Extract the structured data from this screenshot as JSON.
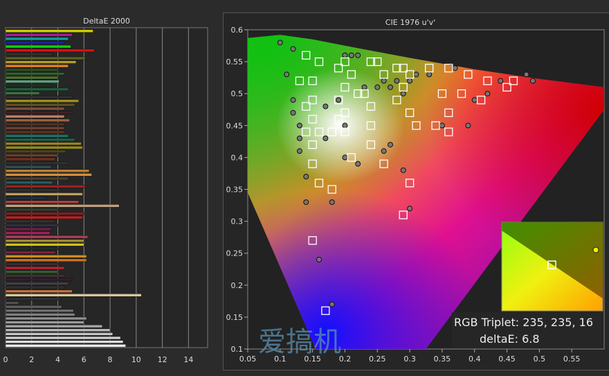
{
  "chart_data": [
    {
      "type": "bar",
      "orientation": "horizontal",
      "title": "DeltaE 2000",
      "xlim": [
        0,
        15
      ],
      "xticks": [
        "0",
        "2",
        "4",
        "6",
        "8",
        "10",
        "12",
        "14"
      ],
      "grid": true,
      "bars": [
        {
          "v": 6.7,
          "c": "#d8d000"
        },
        {
          "v": 5.1,
          "c": "#a020a0"
        },
        {
          "v": 4.8,
          "c": "#10a0a0"
        },
        {
          "v": 4.5,
          "c": "#2020a0"
        },
        {
          "v": 5.0,
          "c": "#10d010"
        },
        {
          "v": 6.8,
          "c": "#e01010"
        },
        {
          "v": 3.6,
          "c": "#303030"
        },
        {
          "v": 6.1,
          "c": "#606020"
        },
        {
          "v": 5.4,
          "c": "#b0a020"
        },
        {
          "v": 4.8,
          "c": "#e08020"
        },
        {
          "v": 4.0,
          "c": "#305020"
        },
        {
          "v": 4.5,
          "c": "#306030"
        },
        {
          "v": 4.0,
          "c": "#507030"
        },
        {
          "v": 4.1,
          "c": "#60a080"
        },
        {
          "v": 3.5,
          "c": "#203020"
        },
        {
          "v": 4.8,
          "c": "#206040"
        },
        {
          "v": 2.6,
          "c": "#407040"
        },
        {
          "v": 5.1,
          "c": "#303030"
        },
        {
          "v": 5.6,
          "c": "#a09020"
        },
        {
          "v": 5.3,
          "c": "#605020"
        },
        {
          "v": 4.5,
          "c": "#805040"
        },
        {
          "v": 5.1,
          "c": "#402020"
        },
        {
          "v": 4.5,
          "c": "#c08060"
        },
        {
          "v": 4.9,
          "c": "#a06040"
        },
        {
          "v": 4.5,
          "c": "#503020"
        },
        {
          "v": 4.5,
          "c": "#704030"
        },
        {
          "v": 4.5,
          "c": "#603020"
        },
        {
          "v": 4.8,
          "c": "#207060"
        },
        {
          "v": 5.3,
          "c": "#206050"
        },
        {
          "v": 5.8,
          "c": "#a08020"
        },
        {
          "v": 5.9,
          "c": "#909020"
        },
        {
          "v": 4.6,
          "c": "#504020"
        },
        {
          "v": 4.0,
          "c": "#604030"
        },
        {
          "v": 3.8,
          "c": "#703020"
        },
        {
          "v": 4.8,
          "c": "#303030"
        },
        {
          "v": 3.5,
          "c": "#305050"
        },
        {
          "v": 6.4,
          "c": "#c08030"
        },
        {
          "v": 6.6,
          "c": "#d09040"
        },
        {
          "v": 4.8,
          "c": "#504030"
        },
        {
          "v": 3.6,
          "c": "#206060"
        },
        {
          "v": 6.1,
          "c": "#a02020"
        },
        {
          "v": 4.2,
          "c": "#303030"
        },
        {
          "v": 5.9,
          "c": "#c0a060"
        },
        {
          "v": 3.1,
          "c": "#203040"
        },
        {
          "v": 5.6,
          "c": "#b04040"
        },
        {
          "v": 8.7,
          "c": "#c0a080"
        },
        {
          "v": 4.0,
          "c": "#304030"
        },
        {
          "v": 6.0,
          "c": "#802020"
        },
        {
          "v": 5.9,
          "c": "#c02020"
        },
        {
          "v": 3.8,
          "c": "#303030"
        },
        {
          "v": 4.0,
          "c": "#303040"
        },
        {
          "v": 3.5,
          "c": "#702040"
        },
        {
          "v": 3.4,
          "c": "#a02060"
        },
        {
          "v": 6.3,
          "c": "#b04050"
        },
        {
          "v": 6.0,
          "c": "#a09030"
        },
        {
          "v": 6.0,
          "c": "#d0c020"
        },
        {
          "v": 4.0,
          "c": "#203020"
        },
        {
          "v": 3.8,
          "c": "#802040"
        },
        {
          "v": 6.2,
          "c": "#d09020"
        },
        {
          "v": 6.2,
          "c": "#d07020"
        },
        {
          "v": 4.0,
          "c": "#303030"
        },
        {
          "v": 4.5,
          "c": "#c02030"
        },
        {
          "v": 4.0,
          "c": "#306030"
        },
        {
          "v": 4.5,
          "c": "#403030"
        },
        {
          "v": 5.1,
          "c": "#302030"
        },
        {
          "v": 4.8,
          "c": "#404040"
        },
        {
          "v": 4.5,
          "c": "#303030"
        },
        {
          "v": 5.1,
          "c": "#c07040"
        },
        {
          "v": 10.4,
          "c": "#d8c8a0"
        },
        {
          "v": 4.2,
          "c": "#303030"
        },
        {
          "v": 1.0,
          "c": "#505050"
        },
        {
          "v": 4.3,
          "c": "#606060"
        },
        {
          "v": 5.2,
          "c": "#707070"
        },
        {
          "v": 5.3,
          "c": "#808080"
        },
        {
          "v": 6.2,
          "c": "#909090"
        },
        {
          "v": 6.0,
          "c": "#9a9a9a"
        },
        {
          "v": 7.4,
          "c": "#a8a8a8"
        },
        {
          "v": 8.0,
          "c": "#b8b8b8"
        },
        {
          "v": 8.2,
          "c": "#c4c4c4"
        },
        {
          "v": 8.8,
          "c": "#d0d0d0"
        },
        {
          "v": 9.0,
          "c": "#dedede"
        },
        {
          "v": 9.2,
          "c": "#eeeeee"
        }
      ]
    },
    {
      "type": "scatter",
      "title": "CIE 1976 u'v'",
      "xlim": [
        0.05,
        0.6
      ],
      "ylim": [
        0.1,
        0.6
      ],
      "xticks": [
        "0.05",
        "0.1",
        "0.15",
        "0.2",
        "0.25",
        "0.3",
        "0.35",
        "0.4",
        "0.45",
        "0.5",
        "0.55"
      ],
      "yticks": [
        "0.1",
        "0.15",
        "0.2",
        "0.25",
        "0.3",
        "0.35",
        "0.4",
        "0.45",
        "0.5",
        "0.55",
        "0.6"
      ],
      "targets": [
        [
          0.14,
          0.56
        ],
        [
          0.16,
          0.55
        ],
        [
          0.15,
          0.52
        ],
        [
          0.13,
          0.52
        ],
        [
          0.15,
          0.49
        ],
        [
          0.14,
          0.48
        ],
        [
          0.15,
          0.46
        ],
        [
          0.14,
          0.44
        ],
        [
          0.16,
          0.44
        ],
        [
          0.15,
          0.42
        ],
        [
          0.15,
          0.39
        ],
        [
          0.16,
          0.36
        ],
        [
          0.18,
          0.35
        ],
        [
          0.15,
          0.27
        ],
        [
          0.17,
          0.16
        ],
        [
          0.2,
          0.55
        ],
        [
          0.19,
          0.54
        ],
        [
          0.21,
          0.53
        ],
        [
          0.2,
          0.51
        ],
        [
          0.19,
          0.49
        ],
        [
          0.2,
          0.47
        ],
        [
          0.19,
          0.46
        ],
        [
          0.2,
          0.44
        ],
        [
          0.18,
          0.44
        ],
        [
          0.21,
          0.4
        ],
        [
          0.23,
          0.5
        ],
        [
          0.24,
          0.55
        ],
        [
          0.25,
          0.55
        ],
        [
          0.26,
          0.53
        ],
        [
          0.24,
          0.48
        ],
        [
          0.24,
          0.45
        ],
        [
          0.24,
          0.42
        ],
        [
          0.26,
          0.39
        ],
        [
          0.28,
          0.54
        ],
        [
          0.29,
          0.54
        ],
        [
          0.3,
          0.53
        ],
        [
          0.29,
          0.51
        ],
        [
          0.28,
          0.49
        ],
        [
          0.3,
          0.47
        ],
        [
          0.31,
          0.45
        ],
        [
          0.3,
          0.36
        ],
        [
          0.29,
          0.31
        ],
        [
          0.33,
          0.54
        ],
        [
          0.36,
          0.54
        ],
        [
          0.35,
          0.5
        ],
        [
          0.36,
          0.47
        ],
        [
          0.36,
          0.44
        ],
        [
          0.34,
          0.45
        ],
        [
          0.39,
          0.53
        ],
        [
          0.41,
          0.49
        ],
        [
          0.42,
          0.52
        ],
        [
          0.45,
          0.51
        ],
        [
          0.46,
          0.52
        ],
        [
          0.38,
          0.5
        ],
        [
          0.22,
          0.5
        ]
      ],
      "measured": [
        [
          0.1,
          0.58
        ],
        [
          0.12,
          0.57
        ],
        [
          0.11,
          0.53
        ],
        [
          0.12,
          0.49
        ],
        [
          0.12,
          0.47
        ],
        [
          0.13,
          0.43
        ],
        [
          0.13,
          0.41
        ],
        [
          0.14,
          0.37
        ],
        [
          0.14,
          0.33
        ],
        [
          0.16,
          0.24
        ],
        [
          0.18,
          0.33
        ],
        [
          0.18,
          0.17
        ],
        [
          0.17,
          0.43
        ],
        [
          0.2,
          0.45
        ],
        [
          0.2,
          0.4
        ],
        [
          0.22,
          0.39
        ],
        [
          0.21,
          0.56
        ],
        [
          0.22,
          0.56
        ],
        [
          0.23,
          0.51
        ],
        [
          0.25,
          0.51
        ],
        [
          0.27,
          0.42
        ],
        [
          0.26,
          0.41
        ],
        [
          0.29,
          0.38
        ],
        [
          0.3,
          0.32
        ],
        [
          0.29,
          0.5
        ],
        [
          0.31,
          0.53
        ],
        [
          0.35,
          0.45
        ],
        [
          0.39,
          0.45
        ],
        [
          0.4,
          0.49
        ],
        [
          0.42,
          0.5
        ],
        [
          0.44,
          0.52
        ],
        [
          0.49,
          0.52
        ],
        [
          0.48,
          0.53
        ],
        [
          0.37,
          0.54
        ],
        [
          0.33,
          0.53
        ],
        [
          0.27,
          0.51
        ],
        [
          0.28,
          0.52
        ],
        [
          0.3,
          0.52
        ],
        [
          0.26,
          0.52
        ],
        [
          0.2,
          0.56
        ],
        [
          0.19,
          0.49
        ],
        [
          0.17,
          0.48
        ],
        [
          0.13,
          0.45
        ]
      ],
      "inset": {
        "rgb_triplet_label": "RGB Triplet: 235, 235, 16",
        "deltae_label": "deltaE: 6.8"
      }
    }
  ],
  "watermark": {
    "text": "爱搞机",
    "sub": "IGAO7.COM"
  }
}
